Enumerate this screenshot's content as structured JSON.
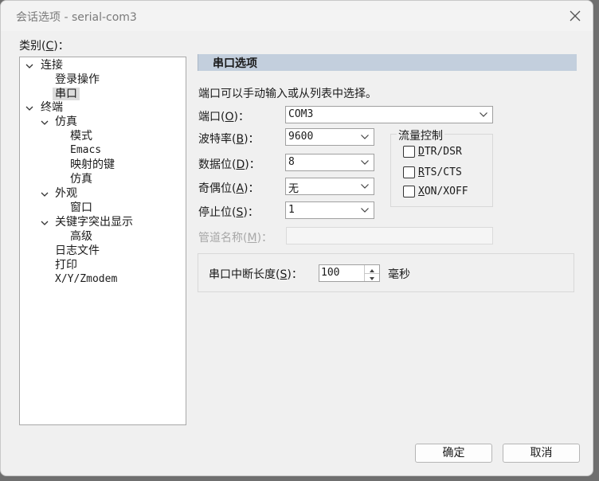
{
  "window": {
    "title": "会话选项 - serial-com3"
  },
  "category": {
    "label_pre": "类别(",
    "label_key": "C",
    "label_post": ")：",
    "tree": {
      "connection": "连接",
      "login_actions": "登录操作",
      "serial": "串口",
      "terminal": "终端",
      "emulation": "仿真",
      "modes": "模式",
      "emacs": "Emacs",
      "mapped_keys": "映射的键",
      "emulation_sub": "仿真",
      "appearance": "外观",
      "window": "窗口",
      "keyword_highlight": "关键字突出显示",
      "advanced": "高级",
      "log_file": "日志文件",
      "printing": "打印",
      "xyzmodem": "X/Y/Zmodem"
    }
  },
  "panel": {
    "header": "串口选项",
    "intro": "端口可以手动输入或从列表中选择。",
    "port": {
      "label_pre": "端口(",
      "label_key": "O",
      "label_post": ")：",
      "value": "COM3"
    },
    "baud": {
      "label_pre": "波特率(",
      "label_key": "B",
      "label_post": ")：",
      "value": "9600"
    },
    "data_bits": {
      "label_pre": "数据位(",
      "label_key": "D",
      "label_post": ")：",
      "value": "8"
    },
    "parity": {
      "label_pre": "奇偶位(",
      "label_key": "A",
      "label_post": ")：",
      "value": "无"
    },
    "stop_bits": {
      "label_pre": "停止位(",
      "label_key": "S",
      "label_post": ")：",
      "value": "1"
    },
    "pipe_name": {
      "label_pre": "管道名称(",
      "label_key": "M",
      "label_post": ")：",
      "value": ""
    },
    "flow_control": {
      "title": "流量控制",
      "dtr": {
        "key": "D",
        "rest": "TR/DSR",
        "checked": false
      },
      "rts": {
        "key": "R",
        "rest": "TS/CTS",
        "checked": false
      },
      "xon": {
        "key": "X",
        "rest": "ON/XOFF",
        "checked": false
      }
    },
    "break_length": {
      "label_pre": "串口中断长度(",
      "label_key": "S",
      "label_post": ")：",
      "value": "100",
      "unit": "毫秒"
    }
  },
  "buttons": {
    "ok": "确定",
    "cancel": "取消"
  }
}
